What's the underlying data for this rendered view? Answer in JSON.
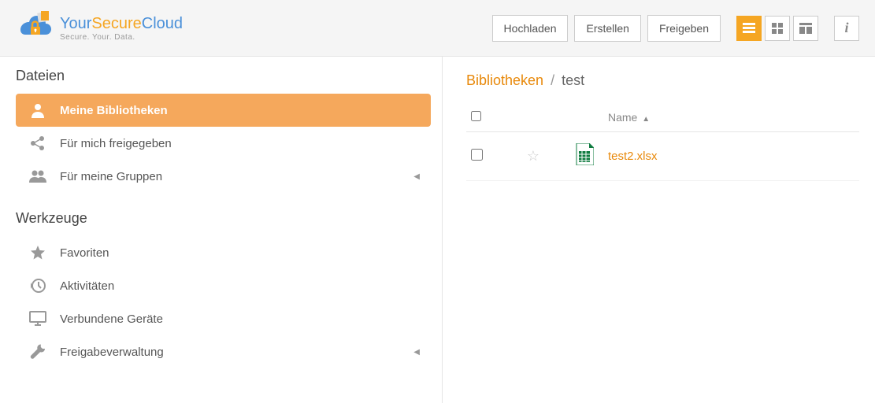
{
  "brand": {
    "prefix": "Your",
    "middle": "Secure",
    "suffix": "Cloud",
    "tagline": "Secure. Your. Data."
  },
  "toolbar": {
    "upload": "Hochladen",
    "create": "Erstellen",
    "share": "Freigeben"
  },
  "sidebar": {
    "files_title": "Dateien",
    "tools_title": "Werkzeuge",
    "files": [
      {
        "label": "Meine Bibliotheken",
        "active": true
      },
      {
        "label": "Für mich freigegeben"
      },
      {
        "label": "Für meine Gruppen",
        "expandable": true
      }
    ],
    "tools": [
      {
        "label": "Favoriten"
      },
      {
        "label": "Aktivitäten"
      },
      {
        "label": "Verbundene Geräte"
      },
      {
        "label": "Freigabeverwaltung",
        "expandable": true
      }
    ]
  },
  "breadcrumb": {
    "root": "Bibliotheken",
    "sep": "/",
    "current": "test"
  },
  "table": {
    "name_header": "Name"
  },
  "files": [
    {
      "name": "test2.xlsx",
      "type": "xlsx"
    }
  ]
}
